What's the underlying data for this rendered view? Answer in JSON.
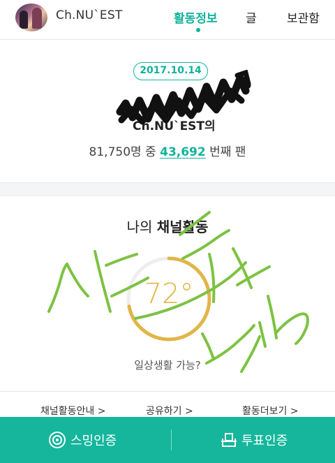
{
  "header": {
    "channel_name": "Ch.NU`EST",
    "nav": [
      "활동정보",
      "글",
      "보관함"
    ]
  },
  "info": {
    "date": "2017.10.14",
    "channel_line": "Ch.NU`EST의",
    "total_fans": "81,750명 중",
    "fan_rank": "43,692",
    "rank_suffix": "번째 팬"
  },
  "activity": {
    "title_prefix": "나의",
    "title_bold": "채널활동",
    "gauge_value": "72°",
    "gauge_percent": 72,
    "status": "일상생활 가능?"
  },
  "links": [
    "채널활동안내 >",
    "공유하기 >",
    "활동더보기 >"
  ],
  "bottom": {
    "streaming": "스밍인증",
    "vote": "투표인증"
  },
  "colors": {
    "accent": "#10b39b",
    "gauge": "#e0b648",
    "doodle": "#7dc242"
  }
}
